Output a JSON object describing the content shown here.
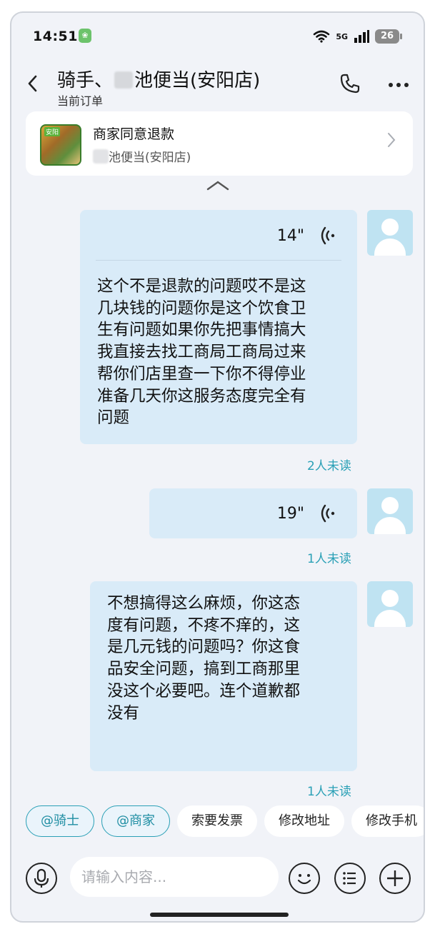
{
  "status_bar": {
    "time": "14:51",
    "network": "5G",
    "battery": "26"
  },
  "header": {
    "title_prefix": "骑手、",
    "title_suffix": "池便当(安阳店)",
    "subtitle": "当前订单"
  },
  "order": {
    "status": "商家同意退款",
    "shop": "池便当(安阳店)",
    "thumb_tag": "安阳"
  },
  "messages": [
    {
      "voice_duration": "14\"",
      "text": "这个不是退款的问题哎不是这\n几块钱的问题你是这个饮食卫\n生有问题如果你先把事情搞大\n我直接去找工商局工商局过来\n帮你们店里查一下你不得停业\n准备几天你这服务态度完全有\n问题",
      "read_status": "2人未读"
    },
    {
      "voice_duration": "19\"",
      "read_status": "1人未读"
    },
    {
      "text": "不想搞得这么麻烦，你这态\n度有问题，不疼不痒的，这\n是几元钱的问题吗？你这食\n品安全问题，搞到工商那里\n没这个必要吧。连个道歉都\n没有",
      "read_status": "1人未读"
    }
  ],
  "quick_replies": [
    "@骑士",
    "@商家",
    "索要发票",
    "修改地址",
    "修改手机"
  ],
  "input": {
    "placeholder": "请输入内容..."
  },
  "icons": {
    "back": "chevron-left-icon",
    "call": "phone-icon",
    "more": "more-dots-icon",
    "voice": "voice-wave-icon",
    "mic": "microphone-icon",
    "emoji": "smiley-icon",
    "list": "list-icon",
    "plus": "plus-icon"
  },
  "colors": {
    "bubble": "#d9ebf8",
    "accent": "#2aa0b6",
    "avatar": "#bfe3f2",
    "background": "#f1f3f8"
  }
}
